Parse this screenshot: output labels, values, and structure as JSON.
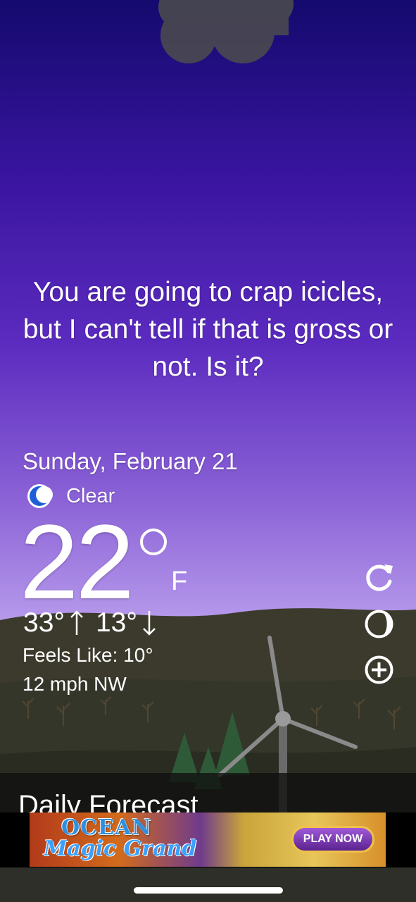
{
  "quote": "You are going to crap icicles, but I can't tell if that is gross or not. Is it?",
  "date": "Sunday, February 21",
  "condition": {
    "icon": "moon-icon",
    "label": "Clear"
  },
  "temperature": {
    "value": "22",
    "unit": "F"
  },
  "high": "33°",
  "low": "13°",
  "feels_like": "Feels Like: 10°",
  "wind": "12 mph NW",
  "actions": [
    {
      "icon": "refresh-icon"
    },
    {
      "icon": "theme-icon"
    },
    {
      "icon": "add-icon"
    }
  ],
  "forecast": {
    "title": "Daily Forecast"
  },
  "ad": {
    "title": "OCEAN",
    "subtitle": "Magic Grand",
    "cta": "PLAY NOW"
  },
  "colors": {
    "sky_top": "#140a6e",
    "sky_bottom": "#c7aaf1",
    "accent_moon": "#1e5fd6"
  }
}
